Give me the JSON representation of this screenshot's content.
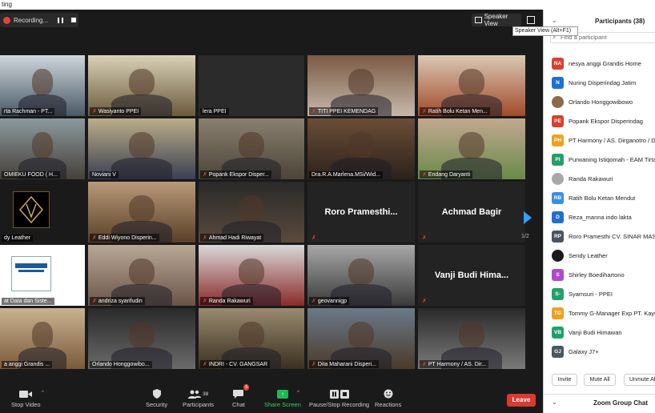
{
  "window": {
    "title": "ting"
  },
  "recording": {
    "label": "Recording..."
  },
  "view": {
    "speaker_view_label": "Speaker View",
    "tooltip": "Speaker View (Alt+F1)"
  },
  "gallery": {
    "tiles": [
      {
        "name": "rta Rachman - PT...",
        "mic_off": false,
        "colors": [
          "#cfd6dc",
          "#4a5a66"
        ]
      },
      {
        "name": "Wasiyanto PPEI",
        "mic_off": true,
        "colors": [
          "#d9d2b8",
          "#6b5a3c"
        ]
      },
      {
        "name": "lera PPEI",
        "mic_off": false,
        "colors": [
          "#2b2b2b",
          "#2b2b2b"
        ]
      },
      {
        "name": "TITI PPEI KEMENDAG",
        "mic_off": true,
        "colors": [
          "#7a5a44",
          "#c7b8aa"
        ]
      },
      {
        "name": "Ratih Bolu Ketan Men...",
        "mic_off": true,
        "colors": [
          "#d9c9b4",
          "#a24a2a"
        ]
      },
      {
        "name": "OMIEKU FOOD ( H...",
        "mic_off": false,
        "colors": [
          "#8c9a9e",
          "#46403a"
        ]
      },
      {
        "name": "Noviani V",
        "mic_off": false,
        "colors": [
          "#bcae8a",
          "#3a3f52"
        ],
        "active": true
      },
      {
        "name": "Popank Ekspor Disper...",
        "mic_off": true,
        "colors": [
          "#8a8070",
          "#4b4438"
        ]
      },
      {
        "name": "Dra.R.A.Marlena.MSi/Wid...",
        "mic_off": false,
        "colors": [
          "#6a4e38",
          "#2c211a"
        ]
      },
      {
        "name": "Endang Daryanti",
        "mic_off": true,
        "colors": [
          "#c2a890",
          "#6a8a4a"
        ]
      },
      {
        "name": "dy Leather",
        "mic_off": false,
        "colors": [
          "#1a1a1a",
          "#1a1a1a"
        ],
        "logo": true
      },
      {
        "name": "Eddi Wiyono Disperin...",
        "mic_off": true,
        "colors": [
          "#b89a78",
          "#5a4028"
        ]
      },
      {
        "name": "Ahmad Hadi Riwayat",
        "mic_off": true,
        "colors": [
          "#2a2a2a",
          "#5a4a3c"
        ]
      },
      {
        "name": "",
        "mic_off": true,
        "big": "Roro Pramesthi...",
        "colors": [
          "#232323",
          "#232323"
        ]
      },
      {
        "name": "",
        "mic_off": true,
        "big": "Achmad Bagir",
        "colors": [
          "#232323",
          "#232323"
        ]
      },
      {
        "name": "at Data dan Siste...",
        "mic_off": false,
        "colors": [
          "#ffffff",
          "#ffffff"
        ],
        "kemendag": true
      },
      {
        "name": "andriza syarifudin",
        "mic_off": true,
        "colors": [
          "#b8a896",
          "#6a5448"
        ]
      },
      {
        "name": "Randa Rakawuri",
        "mic_off": true,
        "colors": [
          "#d8d8d8",
          "#8a2a2a"
        ]
      },
      {
        "name": "geovannigp",
        "mic_off": true,
        "colors": [
          "#a8a8a8",
          "#3a3a3a"
        ]
      },
      {
        "name": "",
        "mic_off": true,
        "big": "Vanji Budi Hima...",
        "colors": [
          "#232323",
          "#232323"
        ]
      },
      {
        "name": "a anggi Grandis ...",
        "mic_off": false,
        "colors": [
          "#c9b290",
          "#7a5a3a"
        ]
      },
      {
        "name": "Orlando Honggowibo...",
        "mic_off": false,
        "colors": [
          "#2a2a2a",
          "#6a6a6a"
        ]
      },
      {
        "name": "INDRI - CV. GANGSAR",
        "mic_off": true,
        "colors": [
          "#9a8a70",
          "#3a3020"
        ]
      },
      {
        "name": "Dita Maharani Disperi...",
        "mic_off": true,
        "colors": [
          "#6a7a8a",
          "#4a3a2a"
        ]
      },
      {
        "name": "PT Harmony / AS. Dir...",
        "mic_off": true,
        "colors": [
          "#2a2a2a",
          "#7a7a7a"
        ]
      }
    ],
    "page_indicator": "1/2"
  },
  "toolbar": {
    "stop_video": "Stop Video",
    "security": "Security",
    "participants": "Participants",
    "participants_count": "38",
    "chat": "Chat",
    "chat_badge": "5",
    "share_screen": "Share Screen",
    "pause_recording": "Pause/Stop Recording",
    "reactions": "Reactions",
    "leave": "Leave"
  },
  "panel": {
    "title": "Participants (38)",
    "search_placeholder": "Find a participant",
    "participants": [
      {
        "initials": "NA",
        "name": "nesya anggi Grandis Home",
        "color": "#d9412e"
      },
      {
        "initials": "N",
        "name": "Nuring Disperindag Jatim",
        "color": "#1f6fd1"
      },
      {
        "initials": "",
        "name": "Orlando Honggowibowo",
        "color": "#8a6a4a"
      },
      {
        "initials": "PE",
        "name": "Popank Ekspor Disperindag",
        "color": "#d9412e"
      },
      {
        "initials": "PH",
        "name": "PT Harmony / AS. Dirganotro / D",
        "color": "#f0a020"
      },
      {
        "initials": "PI",
        "name": "Purwaning Istiqomah - EAM Tirta",
        "color": "#22a06b"
      },
      {
        "initials": "",
        "name": "Randa Rakawuri",
        "color": "#a8a8a8"
      },
      {
        "initials": "RB",
        "name": "Ratih Bolu Ketan Mendut",
        "color": "#3a8ee0"
      },
      {
        "initials": "D",
        "name": "Reza_manna indo lakta",
        "color": "#1f6fd1"
      },
      {
        "initials": "RP",
        "name": "Roro Pramesthi CV. SINAR MAS",
        "color": "#4a5560"
      },
      {
        "initials": "",
        "name": "Sendy Leather",
        "color": "#1a1a1a"
      },
      {
        "initials": "S",
        "name": "Shirley Boedihartono",
        "color": "#b04ac8"
      },
      {
        "initials": "S-",
        "name": "Syamsuri - PPEI",
        "color": "#22a06b"
      },
      {
        "initials": "TG",
        "name": "Tommy G-Manager Exp PT. Kayu",
        "color": "#f0a020"
      },
      {
        "initials": "VB",
        "name": "Vanji Budi Himawan",
        "color": "#22a06b"
      },
      {
        "initials": "GJ",
        "name": "Galaxy J7+",
        "color": "#4a5560"
      }
    ],
    "invite": "Invite",
    "mute_all": "Mute All",
    "unmute_all": "Unmute Al",
    "chat_title": "Zoom Group Chat"
  }
}
